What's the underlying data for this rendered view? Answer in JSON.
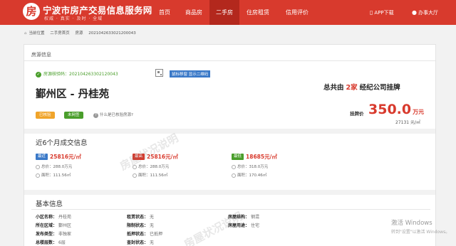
{
  "header": {
    "logo_glyph": "房",
    "site_title": "宁波市房产交易信息服务网",
    "site_slogan": "权威 · 真实 · 及时 · 全域",
    "nav": [
      "首页",
      "商品房",
      "二手房",
      "住房租赁",
      "信用评价"
    ],
    "active_nav": "二手房",
    "app_download": "APP下载",
    "service_hall": "办事大厅",
    "brand_color": "#d83a2d"
  },
  "breadcrumb": {
    "current_label": "当前位置",
    "items": [
      "二手房首页",
      "房源",
      "2021042633021200043"
    ]
  },
  "listing": {
    "panel_title": "房源信息",
    "verify_code": "房源核验码：202104263302120043",
    "qr_tip": "鼠标移窗 显示二维码",
    "name": "鄞州区 - 丹桂苑",
    "tags": [
      "已核验",
      "未网签"
    ],
    "help_text": "什么是已核验房源?",
    "agencies_prefix": "总共由",
    "agencies_count": "2家",
    "agencies_suffix": "经纪公司挂牌",
    "price_label": "挂牌价",
    "price": "350.0",
    "price_unit": "万元",
    "unit_price": "27131 元/㎡"
  },
  "deals": {
    "title": "近6个月成交信息",
    "items": [
      {
        "badge": "最近",
        "price": "25816元/㎡",
        "total": "总价：288.0万元",
        "area": "面积：111.56㎡"
      },
      {
        "badge": "最高",
        "price": "25816元/㎡",
        "total": "总价：288.0万元",
        "area": "面积：111.56㎡"
      },
      {
        "badge": "最低",
        "price": "18685元/㎡",
        "total": "总价：318.0万元",
        "area": "面积：170.46㎡"
      }
    ]
  },
  "basic": {
    "title": "基本信息",
    "col_a": [
      {
        "k": "小区名称：",
        "v": "丹桂苑"
      },
      {
        "k": "所在区域：",
        "v": "鄞州区"
      },
      {
        "k": "发布类型：",
        "v": "非独家"
      },
      {
        "k": "总楼层数：",
        "v": "6层"
      }
    ],
    "col_b": [
      {
        "k": "租赁状态：",
        "v": "无"
      },
      {
        "k": "限制状态：",
        "v": "无"
      },
      {
        "k": "抵押状态：",
        "v": "已抵押"
      },
      {
        "k": "查封状态：",
        "v": "无"
      }
    ],
    "col_c": [
      {
        "k": "房屋结构：",
        "v": "钢混"
      },
      {
        "k": "房屋用途：",
        "v": "住宅"
      }
    ]
  },
  "watermark": "房屋状况说明",
  "os_overlay": {
    "activate": "激活 Windows",
    "activate_sub": "转到\"设置\"以激活 Windows。"
  }
}
